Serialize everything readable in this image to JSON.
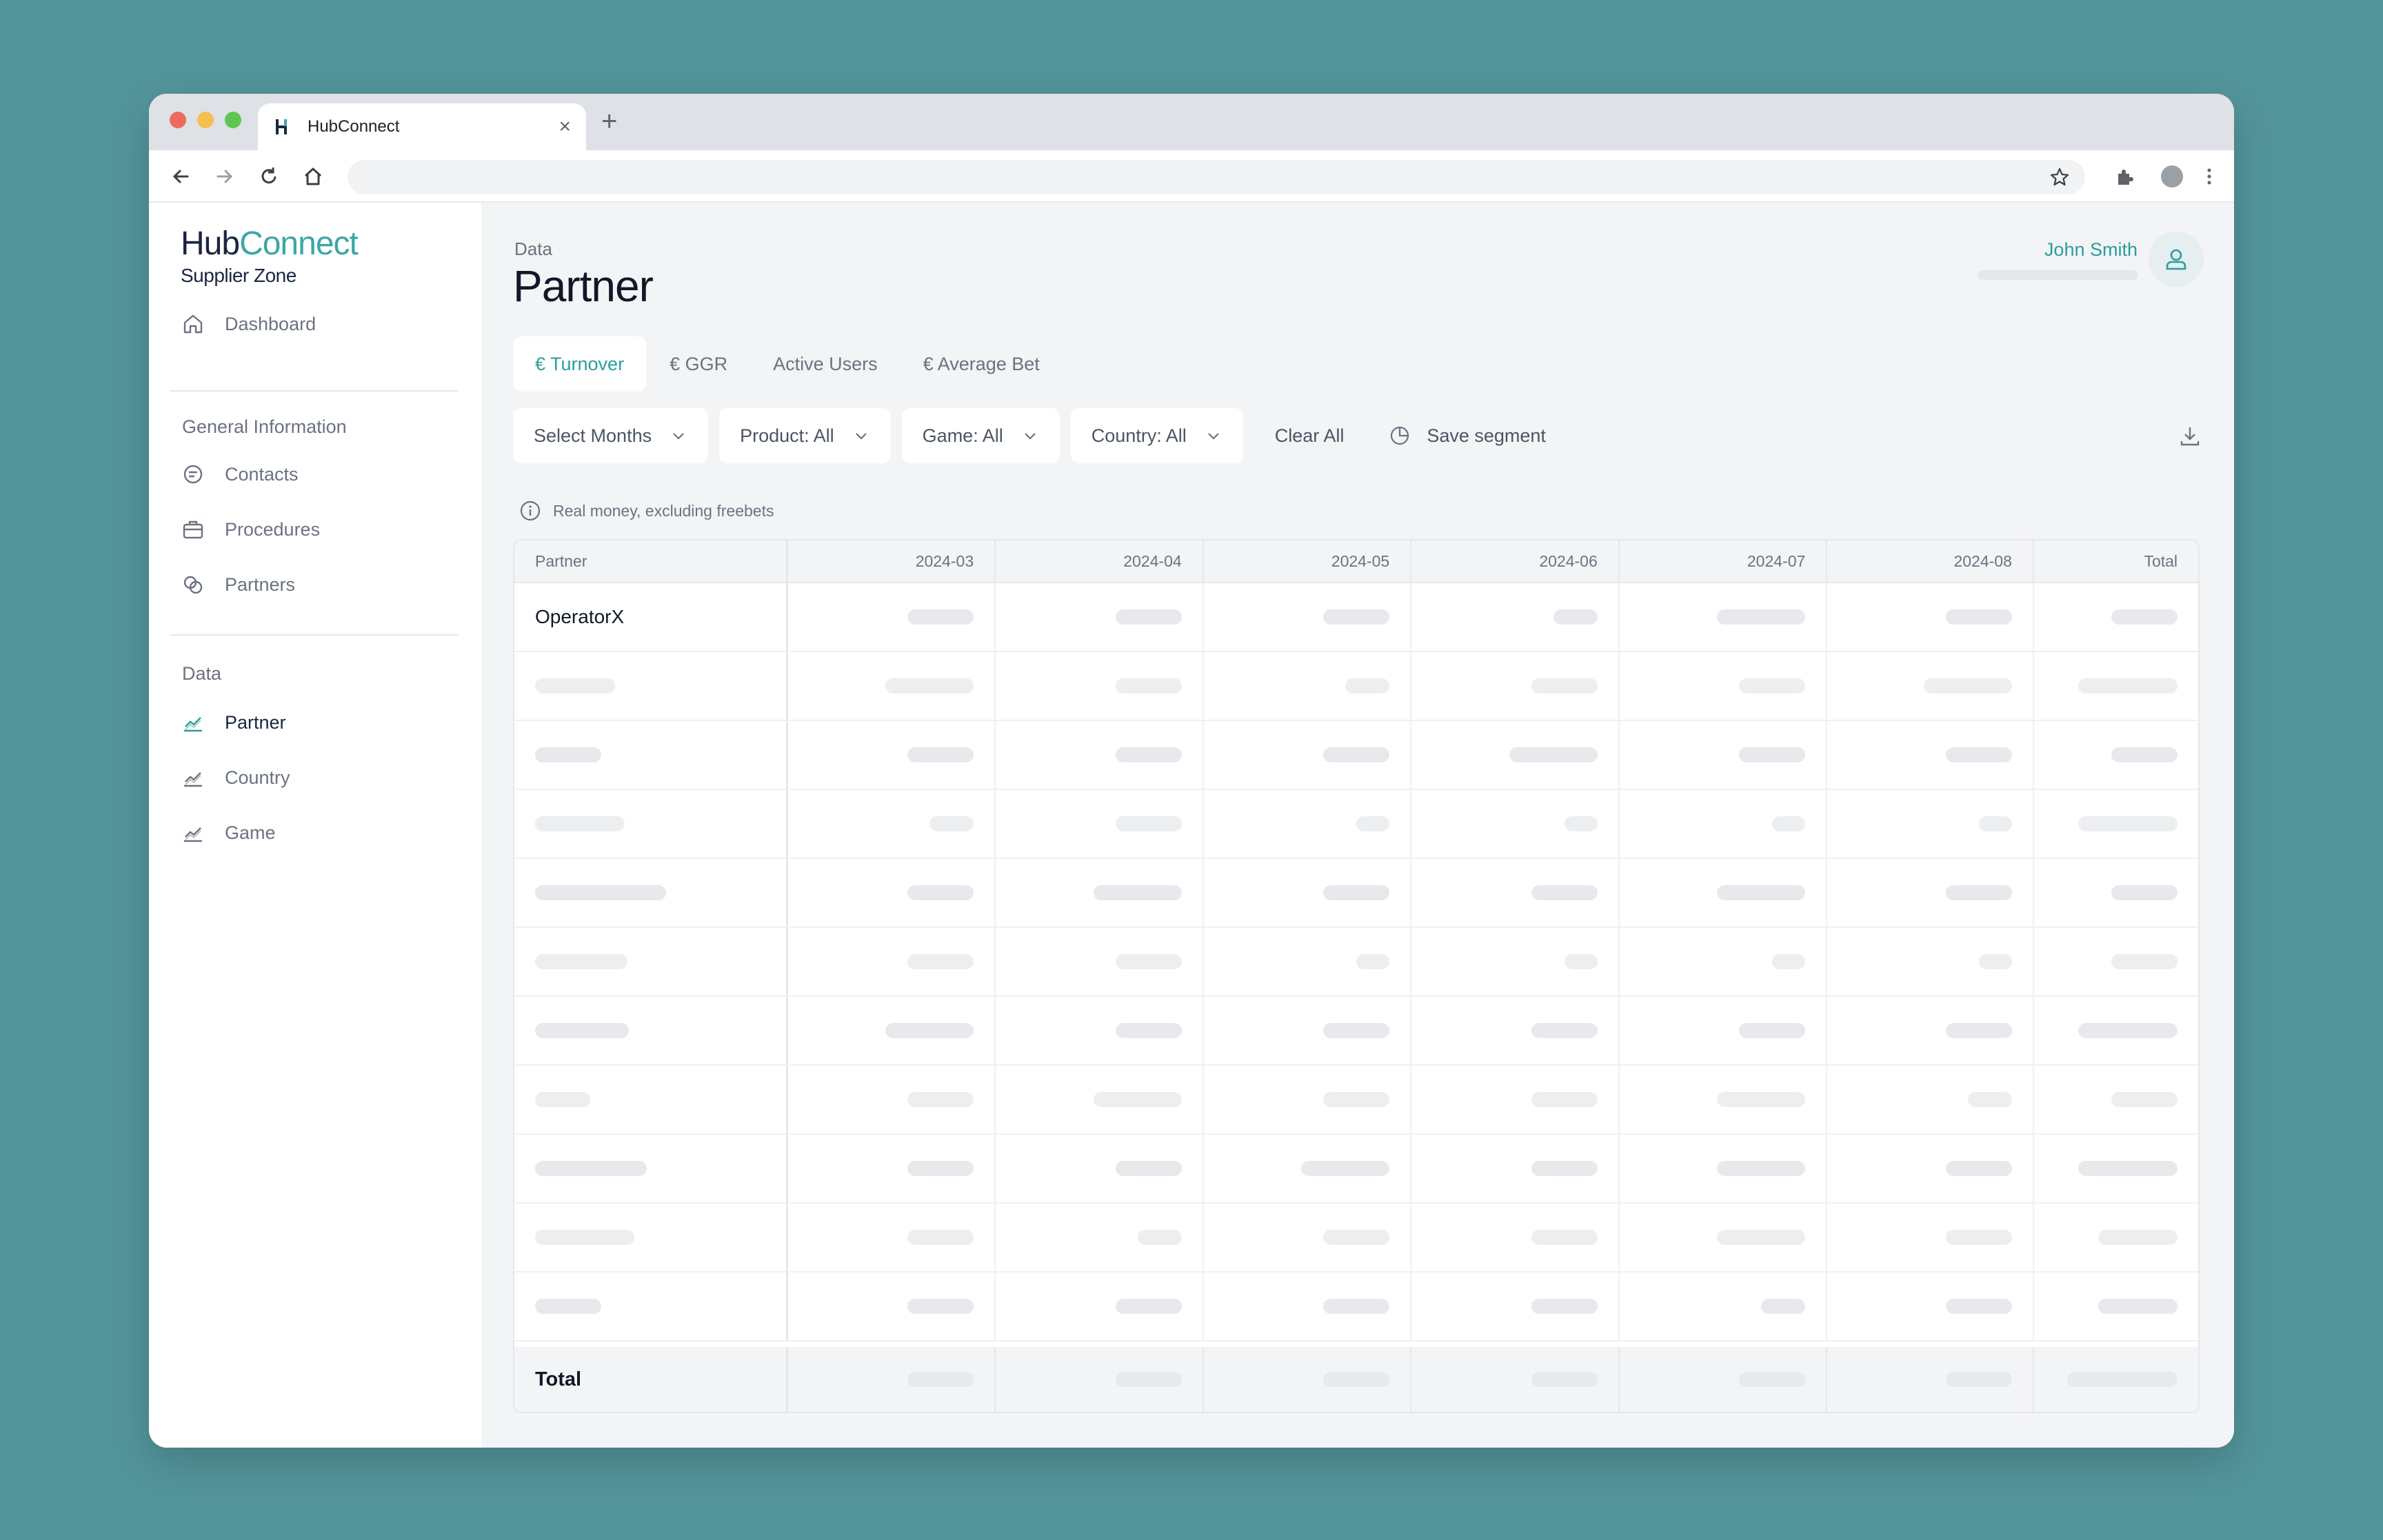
{
  "browser": {
    "tab_title": "HubConnect",
    "tab_close": "×",
    "new_tab": "+"
  },
  "app": {
    "logo_hub": "Hub",
    "logo_connect": "Connect",
    "logo_sub": "Supplier Zone",
    "accent": "#2a9d9d",
    "brand_dark": "#1a2540"
  },
  "sidebar": {
    "dashboard": "Dashboard",
    "section_general": "General Information",
    "contacts": "Contacts",
    "procedures": "Procedures",
    "partners": "Partners",
    "section_data": "Data",
    "partner": "Partner",
    "country": "Country",
    "game": "Game"
  },
  "header": {
    "breadcrumb": "Data",
    "title": "Partner",
    "user_name": "John Smith"
  },
  "metric_tabs": [
    "€ Turnover",
    "€ GGR",
    "Active Users",
    "€ Average Bet"
  ],
  "filters": {
    "months": "Select Months",
    "product": "Product: All",
    "game": "Game: All",
    "country": "Country: All",
    "clear": "Clear All",
    "save": "Save segment"
  },
  "note": "Real money, excluding freebets",
  "table": {
    "columns": [
      "Partner",
      "2024-03",
      "2024-04",
      "2024-05",
      "2024-06",
      "2024-07",
      "2024-08",
      "Total"
    ],
    "first_row": "OperatorX",
    "total_label": "Total"
  }
}
